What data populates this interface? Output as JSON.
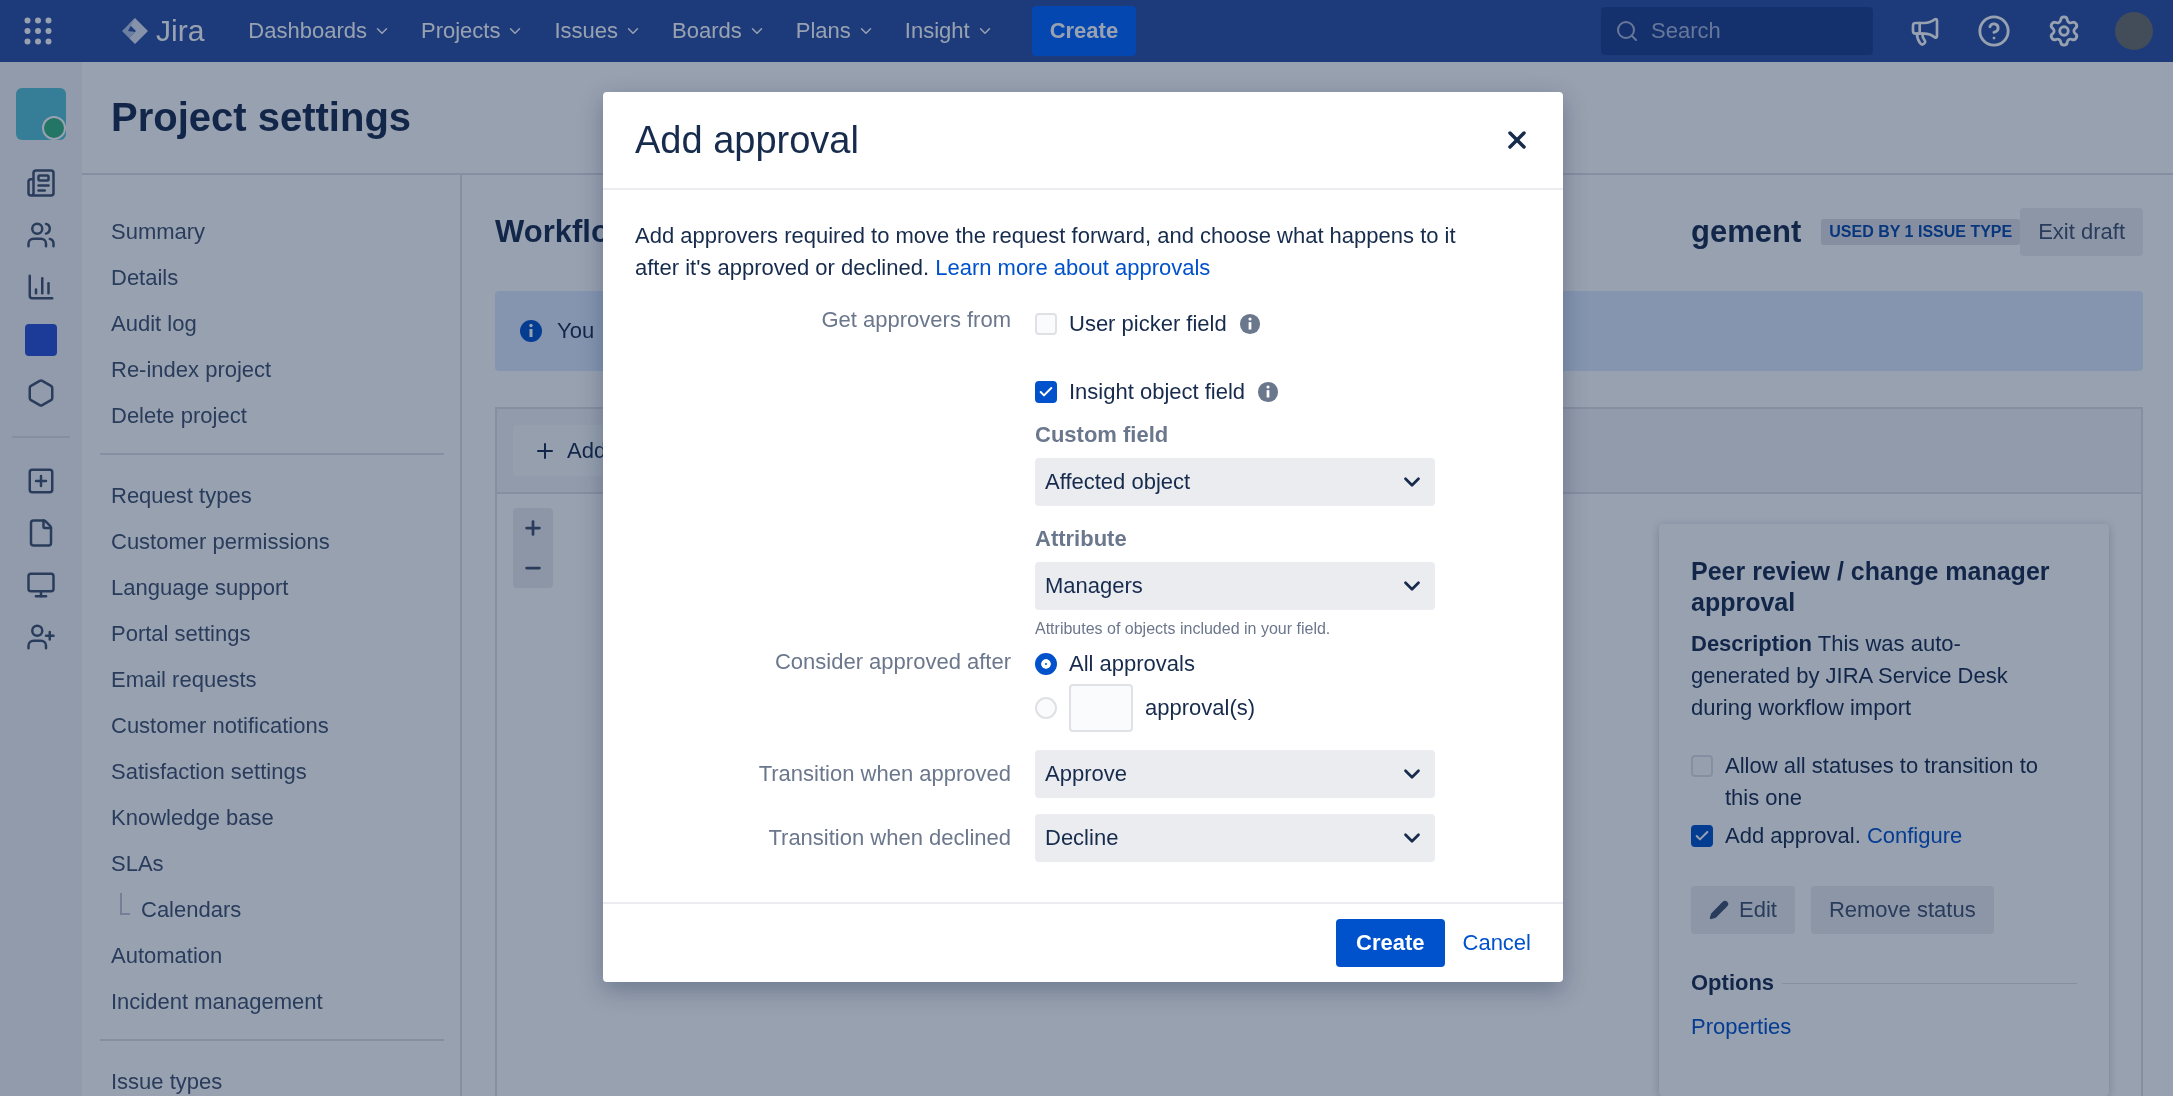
{
  "topbar": {
    "logo": "Jira",
    "nav": [
      {
        "label": "Dashboards"
      },
      {
        "label": "Projects"
      },
      {
        "label": "Issues"
      },
      {
        "label": "Boards"
      },
      {
        "label": "Plans"
      },
      {
        "label": "Insight"
      }
    ],
    "create": "Create",
    "search": {
      "placeholder": "Search"
    }
  },
  "sidebar": {
    "title": "Project settings",
    "groups": [
      {
        "items": [
          {
            "label": "Summary"
          },
          {
            "label": "Details"
          },
          {
            "label": "Audit log"
          },
          {
            "label": "Re-index project"
          },
          {
            "label": "Delete project"
          }
        ]
      },
      {
        "items": [
          {
            "label": "Request types"
          },
          {
            "label": "Customer permissions"
          },
          {
            "label": "Language support"
          },
          {
            "label": "Portal settings"
          },
          {
            "label": "Email requests"
          },
          {
            "label": "Customer notifications"
          },
          {
            "label": "Satisfaction settings"
          },
          {
            "label": "Knowledge base"
          },
          {
            "label": "SLAs",
            "children": [
              {
                "label": "Calendars"
              }
            ]
          },
          {
            "label": "Automation"
          },
          {
            "label": "Incident management"
          }
        ]
      },
      {
        "items": [
          {
            "label": "Issue types"
          }
        ]
      }
    ]
  },
  "main": {
    "title_start": "Workflo",
    "title_end": "gement",
    "badge": "USED BY 1 ISSUE TYPE",
    "exit": "Exit draft",
    "info": "You",
    "add": "Add"
  },
  "panel": {
    "title": "Peer review / change manager approval",
    "description": "**Description** This was auto-generated by JIRA Service Desk during workflow import",
    "options": [
      {
        "label": "Allow all statuses to transition to this one",
        "checked": false
      },
      {
        "label": "Add approval.",
        "link": "Configure",
        "checked": true
      }
    ],
    "buttons": [
      {
        "label": "Edit",
        "kind": "edit"
      },
      {
        "label": "Remove status",
        "kind": "plain"
      }
    ],
    "options_heading": "Options",
    "properties": "Properties"
  },
  "modal": {
    "title": "Add approval",
    "intro": "Add approvers required to move the request forward, and choose what happens to it after it's approved or declined.",
    "intro_link": "Learn more about approvals",
    "approver_label": "Get approvers from",
    "sources": [
      {
        "label": "User picker field",
        "checked": false
      },
      {
        "label": "Insight object field",
        "checked": true
      }
    ],
    "custom_field": {
      "label": "Custom field",
      "value": "Affected object"
    },
    "attribute": {
      "label": "Attribute",
      "value": "Managers",
      "help": "Attributes of objects included in your field."
    },
    "consider": {
      "label": "Consider approved after",
      "options": [
        {
          "label": "All approvals",
          "selected": true,
          "kind": "plain"
        },
        {
          "label": "approval(s)",
          "selected": false,
          "kind": "count"
        }
      ]
    },
    "transitions": [
      {
        "label": "Transition when approved",
        "value": "Approve"
      },
      {
        "label": "Transition when declined",
        "value": "Decline"
      }
    ],
    "create": "Create",
    "cancel": "Cancel"
  }
}
